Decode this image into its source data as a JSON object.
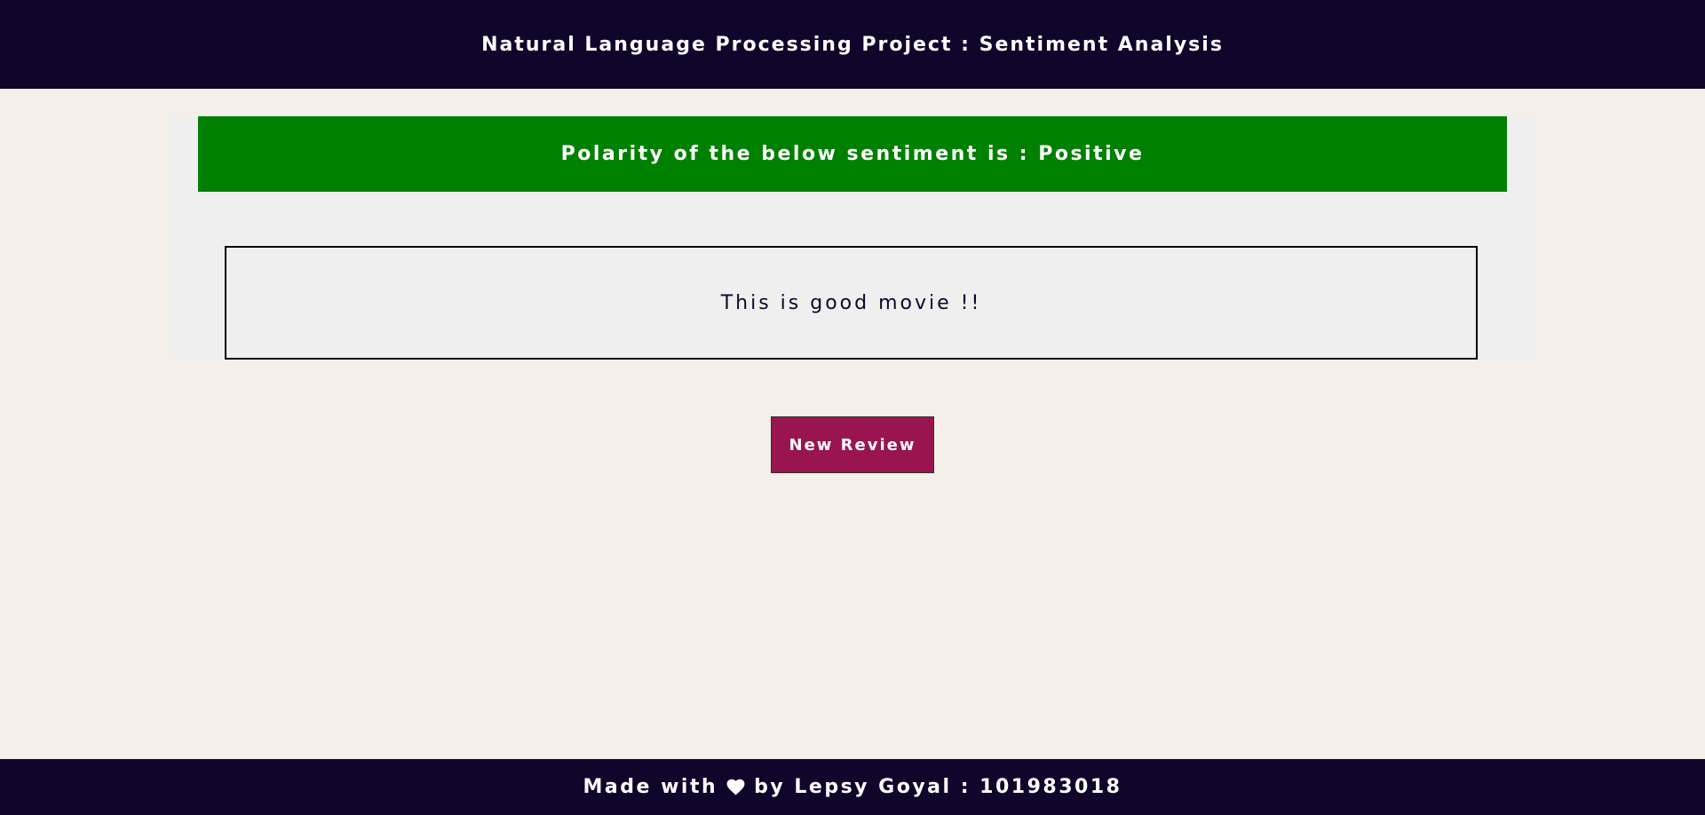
{
  "colors": {
    "header_bg": "#12052b",
    "page_bg": "#f4efe8",
    "panel_bg": "#efefef",
    "positive": "#008000",
    "button_bg": "#9a1550"
  },
  "header": {
    "title": "Natural Language Processing Project : Sentiment Analysis"
  },
  "result": {
    "polarity_text": "Polarity of the below sentiment is : Positive",
    "review_text": "This is good movie !!"
  },
  "actions": {
    "new_review_label": "New Review"
  },
  "footer": {
    "made_with": "Made with",
    "heart_icon": "heart-icon",
    "by_text": "by Lepsy Goyal : 101983018"
  }
}
